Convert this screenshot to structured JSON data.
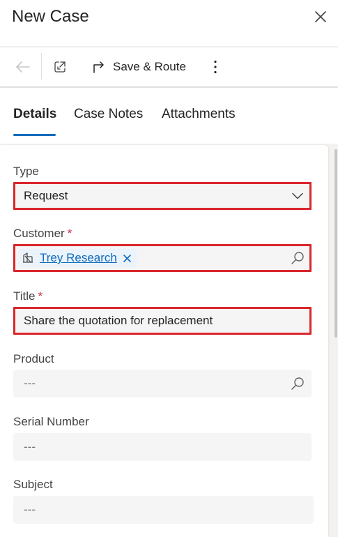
{
  "header": {
    "title": "New Case"
  },
  "toolbar": {
    "save_route_label": "Save & Route"
  },
  "tabs": [
    {
      "label": "Details",
      "active": true
    },
    {
      "label": "Case Notes",
      "active": false
    },
    {
      "label": "Attachments",
      "active": false
    }
  ],
  "fields": {
    "type": {
      "label": "Type",
      "value": "Request"
    },
    "customer": {
      "label": "Customer",
      "required_mark": "*",
      "value": "Trey Research"
    },
    "title": {
      "label": "Title",
      "required_mark": "*",
      "value": "Share the quotation for replacement"
    },
    "product": {
      "label": "Product",
      "placeholder": "---"
    },
    "serial_number": {
      "label": "Serial Number",
      "placeholder": "---"
    },
    "subject": {
      "label": "Subject",
      "placeholder": "---"
    }
  },
  "colors": {
    "accent": "#0f6cbd",
    "highlight": "#d9262c",
    "required": "#c4314b"
  },
  "icons": [
    "close-icon",
    "back-arrow-icon",
    "popout-icon",
    "save-route-icon",
    "more-vertical-icon",
    "chevron-down-icon",
    "account-icon",
    "dismiss-icon",
    "search-icon"
  ]
}
